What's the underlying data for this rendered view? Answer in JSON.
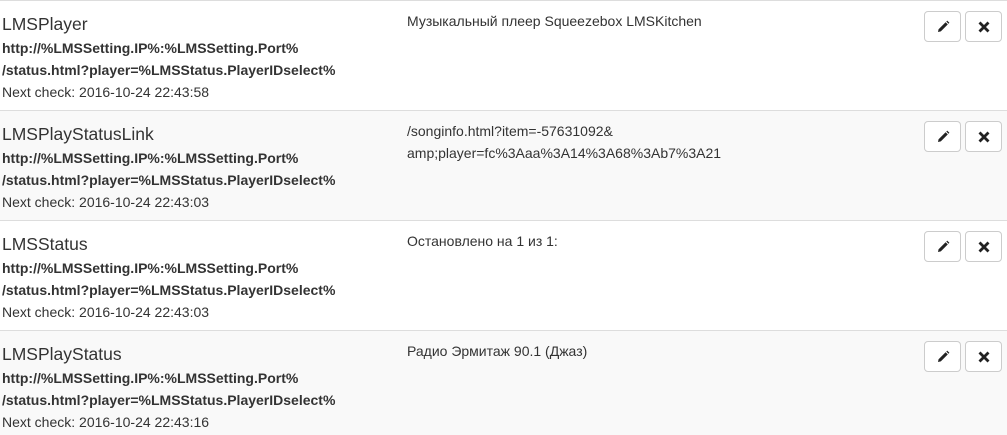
{
  "rows": [
    {
      "name": "LMSPlayer",
      "url_line1": "http://%LMSSetting.IP%:%LMSSetting.Port%",
      "url_line2": "/status.html?player=%LMSStatus.PlayerIDselect%",
      "next_check": "Next check: 2016-10-24 22:43:58",
      "value_line1": "Музыкальный плеер Squeezebox LMSKitchen",
      "value_line2": ""
    },
    {
      "name": "LMSPlayStatusLink",
      "url_line1": "http://%LMSSetting.IP%:%LMSSetting.Port%",
      "url_line2": "/status.html?player=%LMSStatus.PlayerIDselect%",
      "next_check": "Next check: 2016-10-24 22:43:03",
      "value_line1": "/songinfo.html?item=-57631092&",
      "value_line2": "amp;player=fc%3Aaa%3A14%3A68%3Ab7%3A21"
    },
    {
      "name": "LMSStatus",
      "url_line1": "http://%LMSSetting.IP%:%LMSSetting.Port%",
      "url_line2": "/status.html?player=%LMSStatus.PlayerIDselect%",
      "next_check": "Next check: 2016-10-24 22:43:03",
      "value_line1": "Остановлено на 1 из 1:",
      "value_line2": ""
    },
    {
      "name": "LMSPlayStatus",
      "url_line1": "http://%LMSSetting.IP%:%LMSSetting.Port%",
      "url_line2": "/status.html?player=%LMSStatus.PlayerIDselect%",
      "next_check": "Next check: 2016-10-24 22:43:16",
      "value_line1": "Радио Эрмитаж 90.1 (Джаз)",
      "value_line2": ""
    }
  ],
  "icons": {
    "edit": "pencil-icon",
    "delete": "close-icon"
  },
  "colors": {
    "row_stripe": "#f9f9f9",
    "border": "#dddddd",
    "text": "#333333"
  }
}
